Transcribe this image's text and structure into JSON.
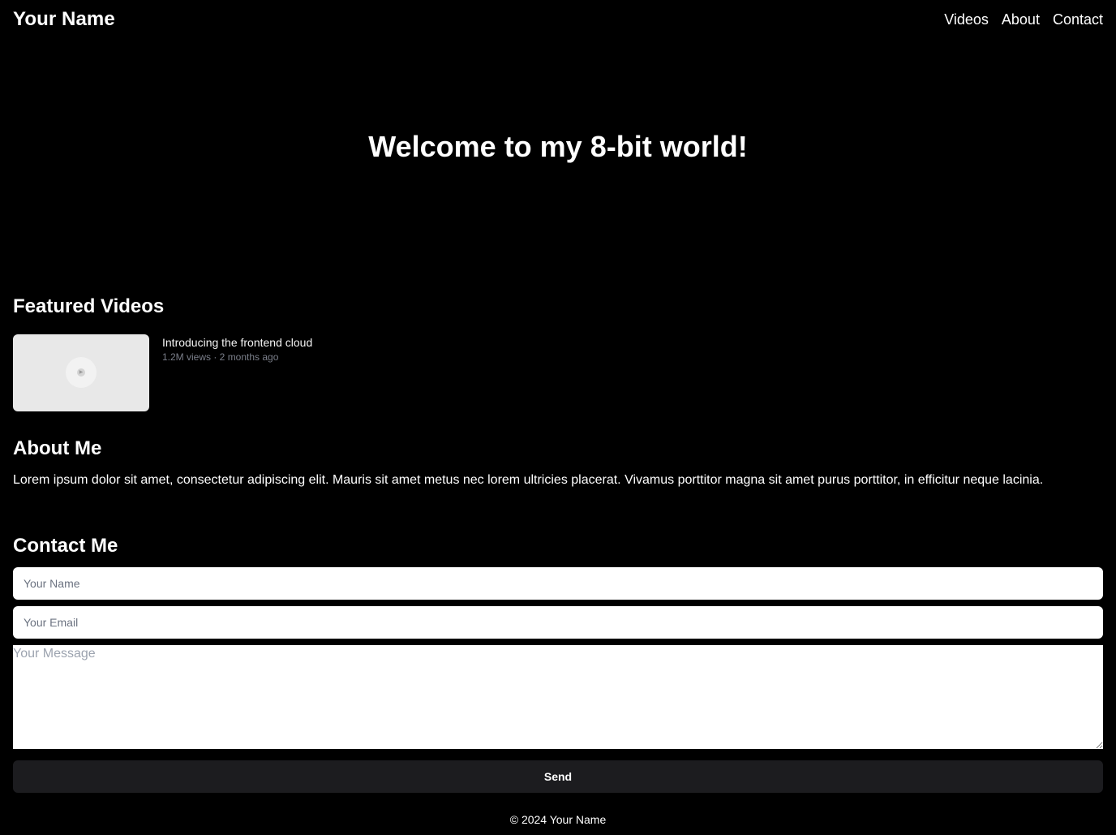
{
  "header": {
    "brand": "Your Name",
    "nav": [
      "Videos",
      "About",
      "Contact"
    ]
  },
  "hero": {
    "title": "Welcome to my 8-bit world!"
  },
  "featured": {
    "title": "Featured Videos",
    "videos": [
      {
        "title": "Introducing the frontend cloud",
        "meta": "1.2M views · 2 months ago"
      }
    ]
  },
  "about": {
    "title": "About Me",
    "text": "Lorem ipsum dolor sit amet, consectetur adipiscing elit. Mauris sit amet metus nec lorem ultricies placerat. Vivamus porttitor magna sit amet purus porttitor, in efficitur neque lacinia."
  },
  "contact": {
    "title": "Contact Me",
    "name_placeholder": "Your Name",
    "email_placeholder": "Your Email",
    "message_placeholder": "Your Message",
    "send_label": "Send"
  },
  "footer": {
    "text": "© 2024 Your Name"
  },
  "colors": {
    "background": "#000000",
    "text": "#ffffff",
    "muted": "#7b7f8a",
    "button": "#1c1c1f"
  }
}
